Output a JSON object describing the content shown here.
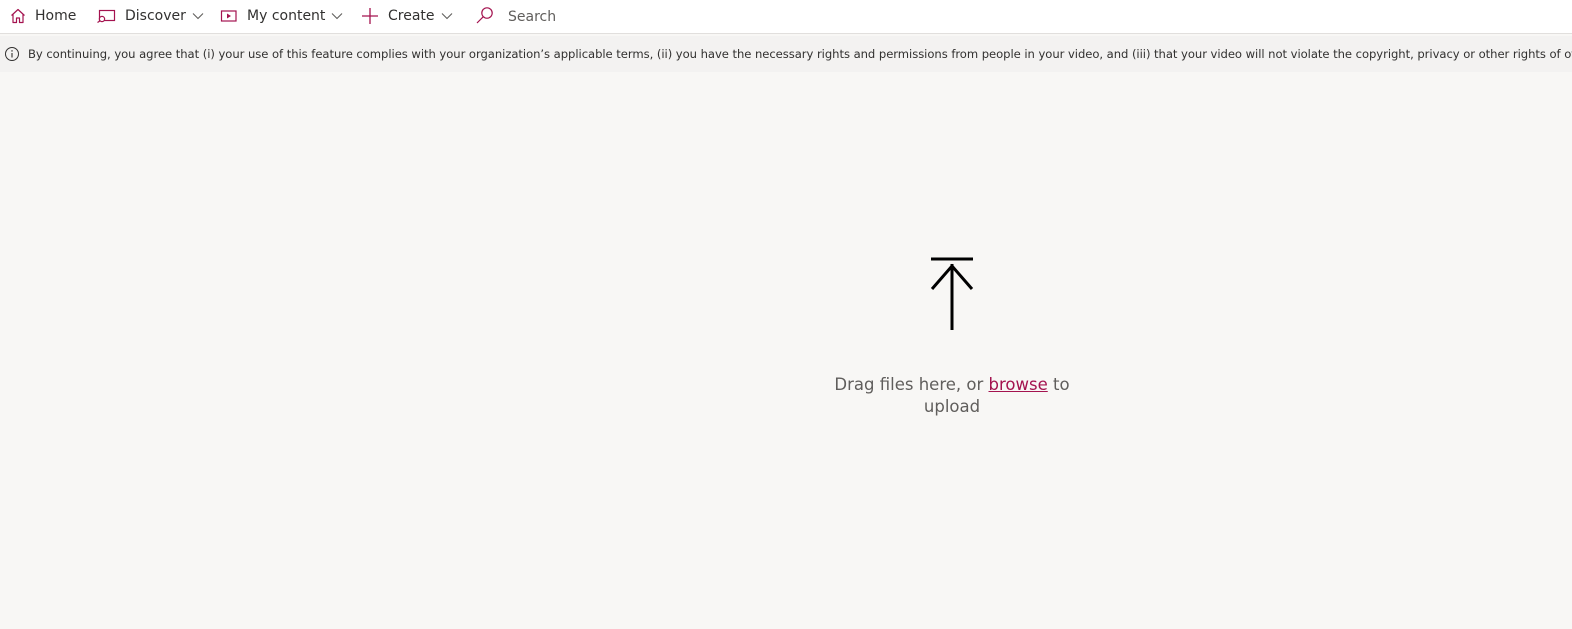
{
  "nav": {
    "home": "Home",
    "discover": "Discover",
    "my_content": "My content",
    "create": "Create",
    "search_placeholder": "Search"
  },
  "info": {
    "message": "By continuing, you agree that (i) your use of this feature complies with your organization’s applicable terms, (ii) you have the necessary rights and permissions from people in your video, and (iii) that your video will not violate the copyright, privacy or other rights of others."
  },
  "upload": {
    "prefix": "Drag files here, or ",
    "browse": "browse",
    "suffix": " to upload"
  },
  "icons": {
    "home": "home-icon",
    "discover": "discover-icon",
    "my_content": "video-icon",
    "create": "plus-icon",
    "search": "search-icon",
    "info": "info-icon",
    "upload": "upload-arrow-icon",
    "chevron": "chevron-down-icon"
  },
  "colors": {
    "accent": "#a4134f",
    "background": "#f8f7f5",
    "infobar": "#f3f2f1",
    "text": "#323130",
    "muted_text": "#605e5c"
  }
}
